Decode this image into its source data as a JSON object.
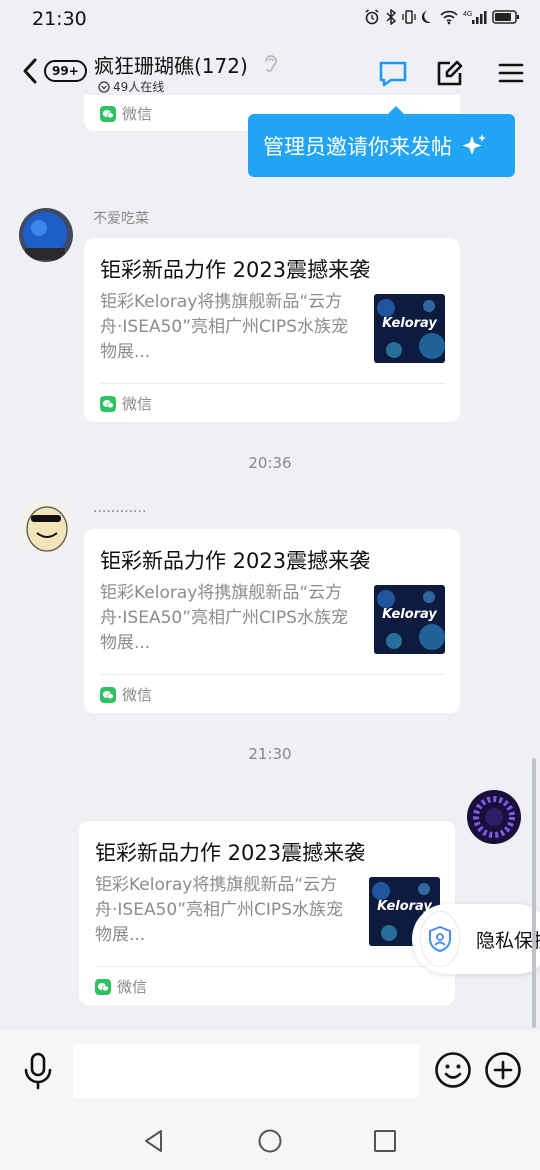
{
  "status_bar": {
    "time": "21:30",
    "network": "4G"
  },
  "header": {
    "unread_badge": "99+",
    "group_name": "疯狂珊瑚礁(172)",
    "online_count": "49人在线",
    "accent_color": "#1e9bf0"
  },
  "tooltip": {
    "text": "管理员邀请你来发帖"
  },
  "prev_card": {
    "source": "微信"
  },
  "messages": [
    {
      "sender": "不爱吃菜",
      "title": "钜彩新品力作 2023震撼来袭",
      "desc": "钜彩Keloray将携旗舰新品“云方舟·ISEA50”亮相广州CIPS水族宠物展...",
      "thumb_brand": "Keloray",
      "source": "微信"
    },
    {
      "sender": "............",
      "title": "钜彩新品力作 2023震撼来袭",
      "desc": "钜彩Keloray将携旗舰新品“云方舟·ISEA50”亮相广州CIPS水族宠物展...",
      "thumb_brand": "Keloray",
      "source": "微信"
    },
    {
      "title": "钜彩新品力作 2023震撼来袭",
      "desc": "钜彩Keloray将携旗舰新品“云方舟·ISEA50”亮相广州CIPS水族宠物展...",
      "thumb_brand": "Keloray",
      "source": "微信"
    }
  ],
  "timestamps": [
    "20:36",
    "21:30"
  ],
  "privacy_pill": {
    "label": "隐私保护"
  },
  "input_bar": {
    "placeholder": ""
  },
  "icons": {
    "back": "chevron-left-icon",
    "chat": "chat-bubble-icon",
    "post": "edit-icon",
    "menu": "hamburger-menu-icon",
    "mic": "microphone-icon",
    "emoji": "smiley-icon",
    "plus": "plus-circle-icon",
    "privacy": "shield-icon"
  }
}
